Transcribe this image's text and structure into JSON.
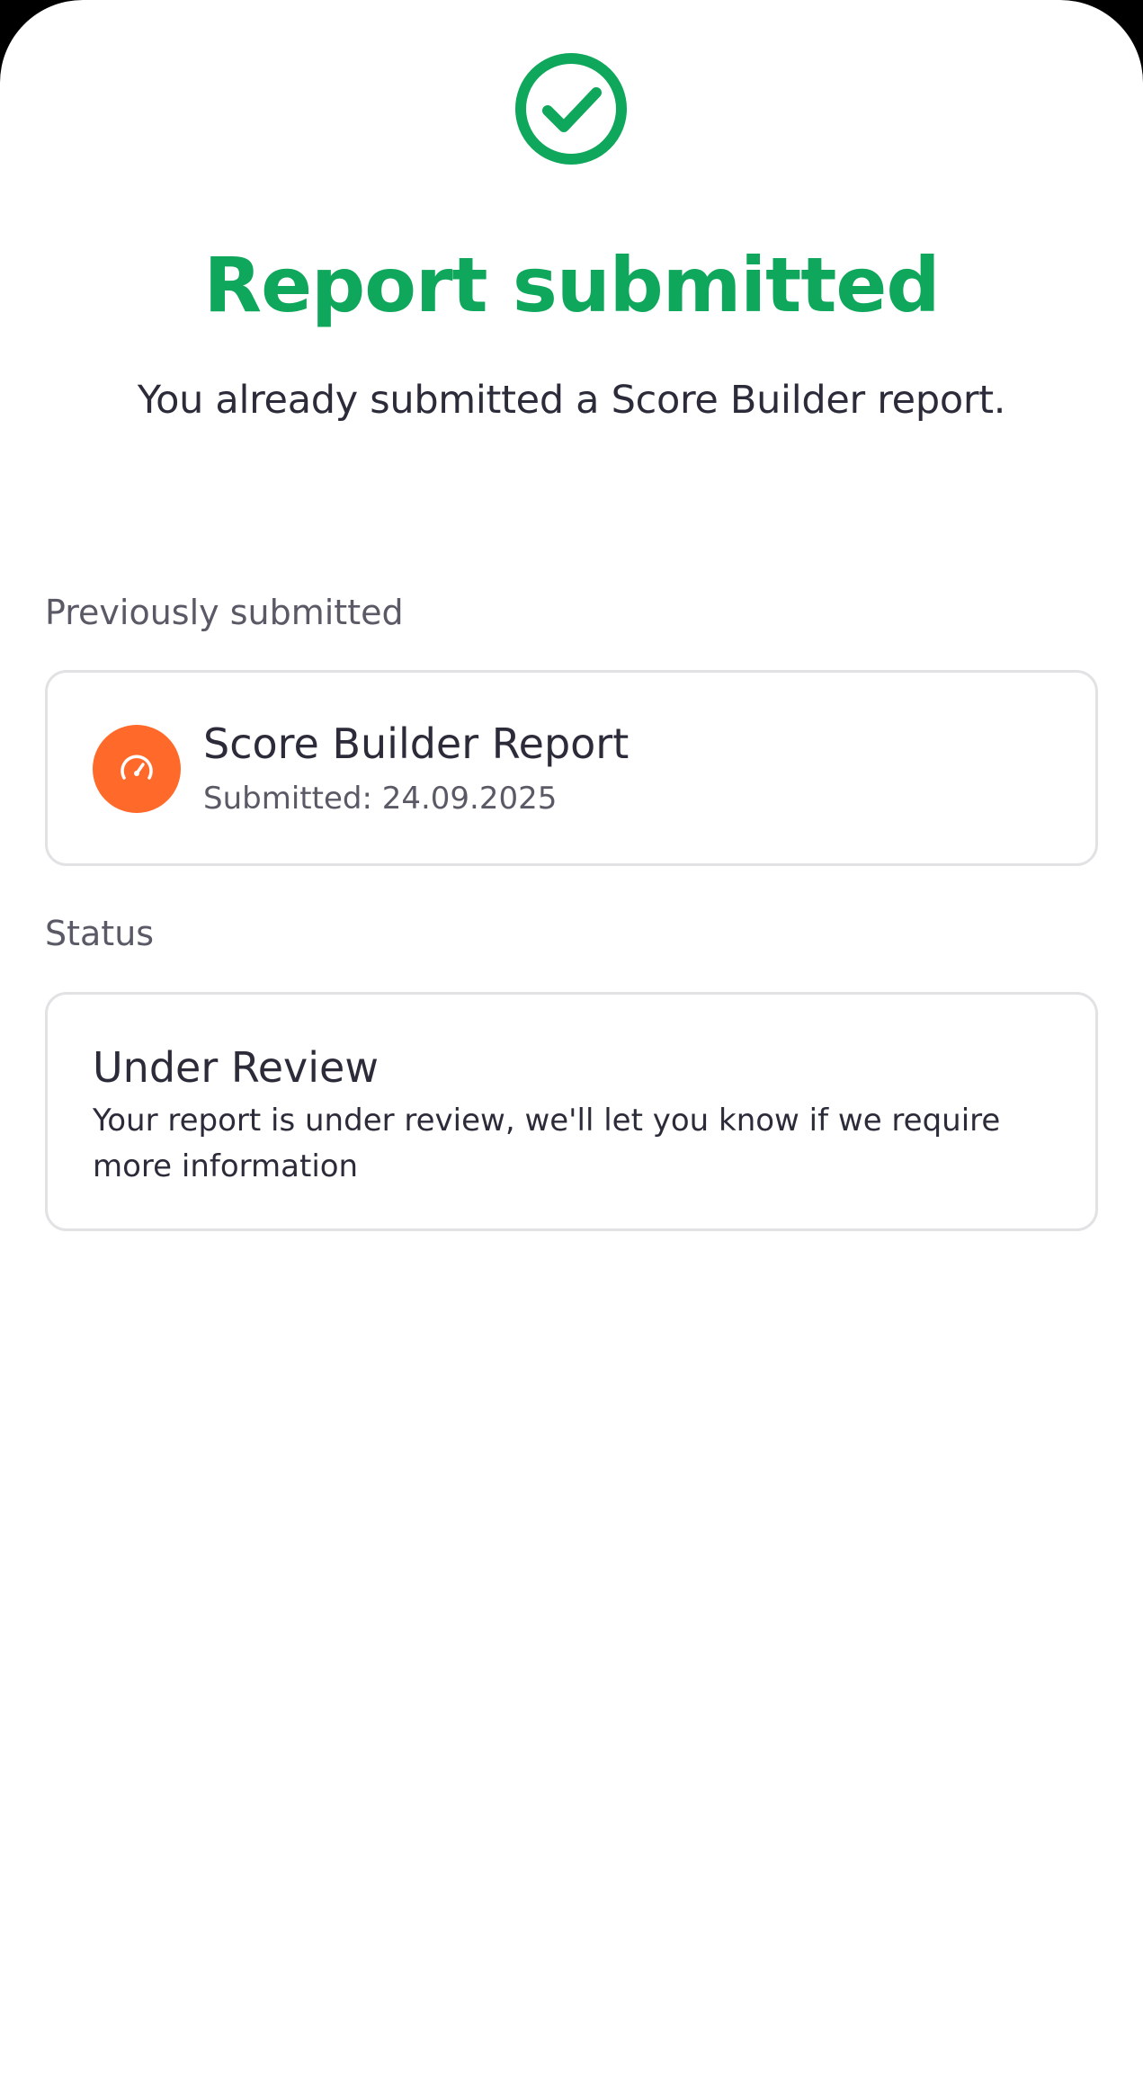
{
  "colors": {
    "success": "#0fa75b",
    "report_icon_bg": "#ff6a2b",
    "text_primary": "#2b2b3a",
    "text_secondary": "#5a5a66",
    "card_border": "#e2e2e5"
  },
  "header": {
    "icon": "check-circle-icon",
    "title": "Report submitted",
    "subtitle": "You already submitted a Score Builder report."
  },
  "previous": {
    "label": "Previously submitted",
    "report": {
      "icon": "speedometer-icon",
      "title": "Score Builder Report",
      "submitted": "Submitted: 24.09.2025"
    }
  },
  "status": {
    "label": "Status",
    "title": "Under Review",
    "description": "Your report is under review, we'll let you know if we require more information"
  }
}
